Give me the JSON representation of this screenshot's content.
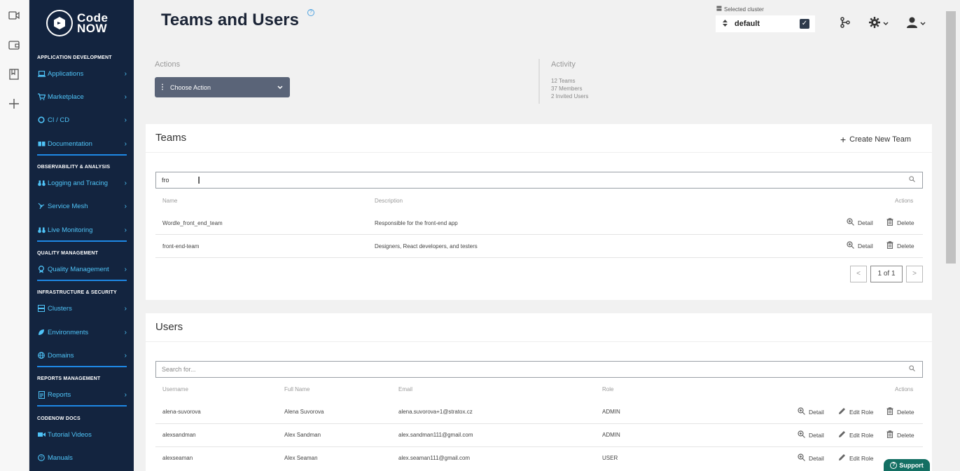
{
  "strip": {
    "icons": [
      "video-icon",
      "wallet-icon",
      "book-icon",
      "plus-icon"
    ]
  },
  "logo": {
    "line1": "Code",
    "line2": "NOW"
  },
  "sidebar": {
    "sections": {
      "app_dev": "APPLICATION DEVELOPMENT",
      "observability": "OBSERVABILITY & ANALYSIS",
      "quality": "QUALITY MANAGEMENT",
      "infra": "INFRASTRUCTURE & SECURITY",
      "reports": "REPORTS MANAGEMENT",
      "docs": "CODENOW DOCS"
    },
    "items": {
      "applications": "Applications",
      "marketplace": "Marketplace",
      "cicd": "CI / CD",
      "documentation": "Documentation",
      "logging": "Logging and Tracing",
      "service_mesh": "Service Mesh",
      "live_monitoring": "Live Monitoring",
      "quality_management": "Quality Management",
      "clusters": "Clusters",
      "environments": "Environments",
      "domains": "Domains",
      "reports": "Reports",
      "tutorial_videos": "Tutorial Videos",
      "manuals": "Manuals"
    }
  },
  "header": {
    "title": "Teams and Users",
    "cluster_label": "Selected cluster",
    "cluster_value": "default"
  },
  "actions": {
    "label": "Actions",
    "choose": "Choose Action"
  },
  "activity": {
    "label": "Activity",
    "teams": "12 Teams",
    "members": "37 Members",
    "invited": "2 Invited Users"
  },
  "teams": {
    "title": "Teams",
    "create": "Create New Team",
    "search_value": "fro",
    "columns": {
      "name": "Name",
      "description": "Description",
      "actions": "Actions"
    },
    "rows": [
      {
        "name": "Wordle_front_end_team",
        "description": "Responsible for the front-end app"
      },
      {
        "name": "front-end-team",
        "description": "Designers, React developers, and testers"
      }
    ],
    "detail": "Detail",
    "delete": "Delete",
    "pager": {
      "prev": "<",
      "page": "1 of 1",
      "next": ">"
    }
  },
  "users": {
    "title": "Users",
    "search_placeholder": "Search for...",
    "columns": {
      "username": "Username",
      "full_name": "Full Name",
      "email": "Email",
      "role": "Role",
      "actions": "Actions"
    },
    "rows": [
      {
        "username": "alena-suvorova",
        "full_name": "Alena Suvorova",
        "email": "alena.suvorova+1@stratox.cz",
        "role": "ADMIN"
      },
      {
        "username": "alexsandman",
        "full_name": "Alex Sandman",
        "email": "alex.sandman111@gmail.com",
        "role": "ADMIN"
      },
      {
        "username": "alexseaman",
        "full_name": "Alex Seaman",
        "email": "alex.seaman111@gmail.com",
        "role": "USER"
      }
    ],
    "detail": "Detail",
    "edit_role": "Edit Role",
    "delete": "Delete"
  },
  "support": {
    "label": "Support"
  },
  "colors": {
    "sidebar_bg": "#13243f",
    "nav_link": "#4fc3f7",
    "accent_line": "#1e88e5",
    "support_bg": "#136f63",
    "action_btn": "#5a6478"
  }
}
